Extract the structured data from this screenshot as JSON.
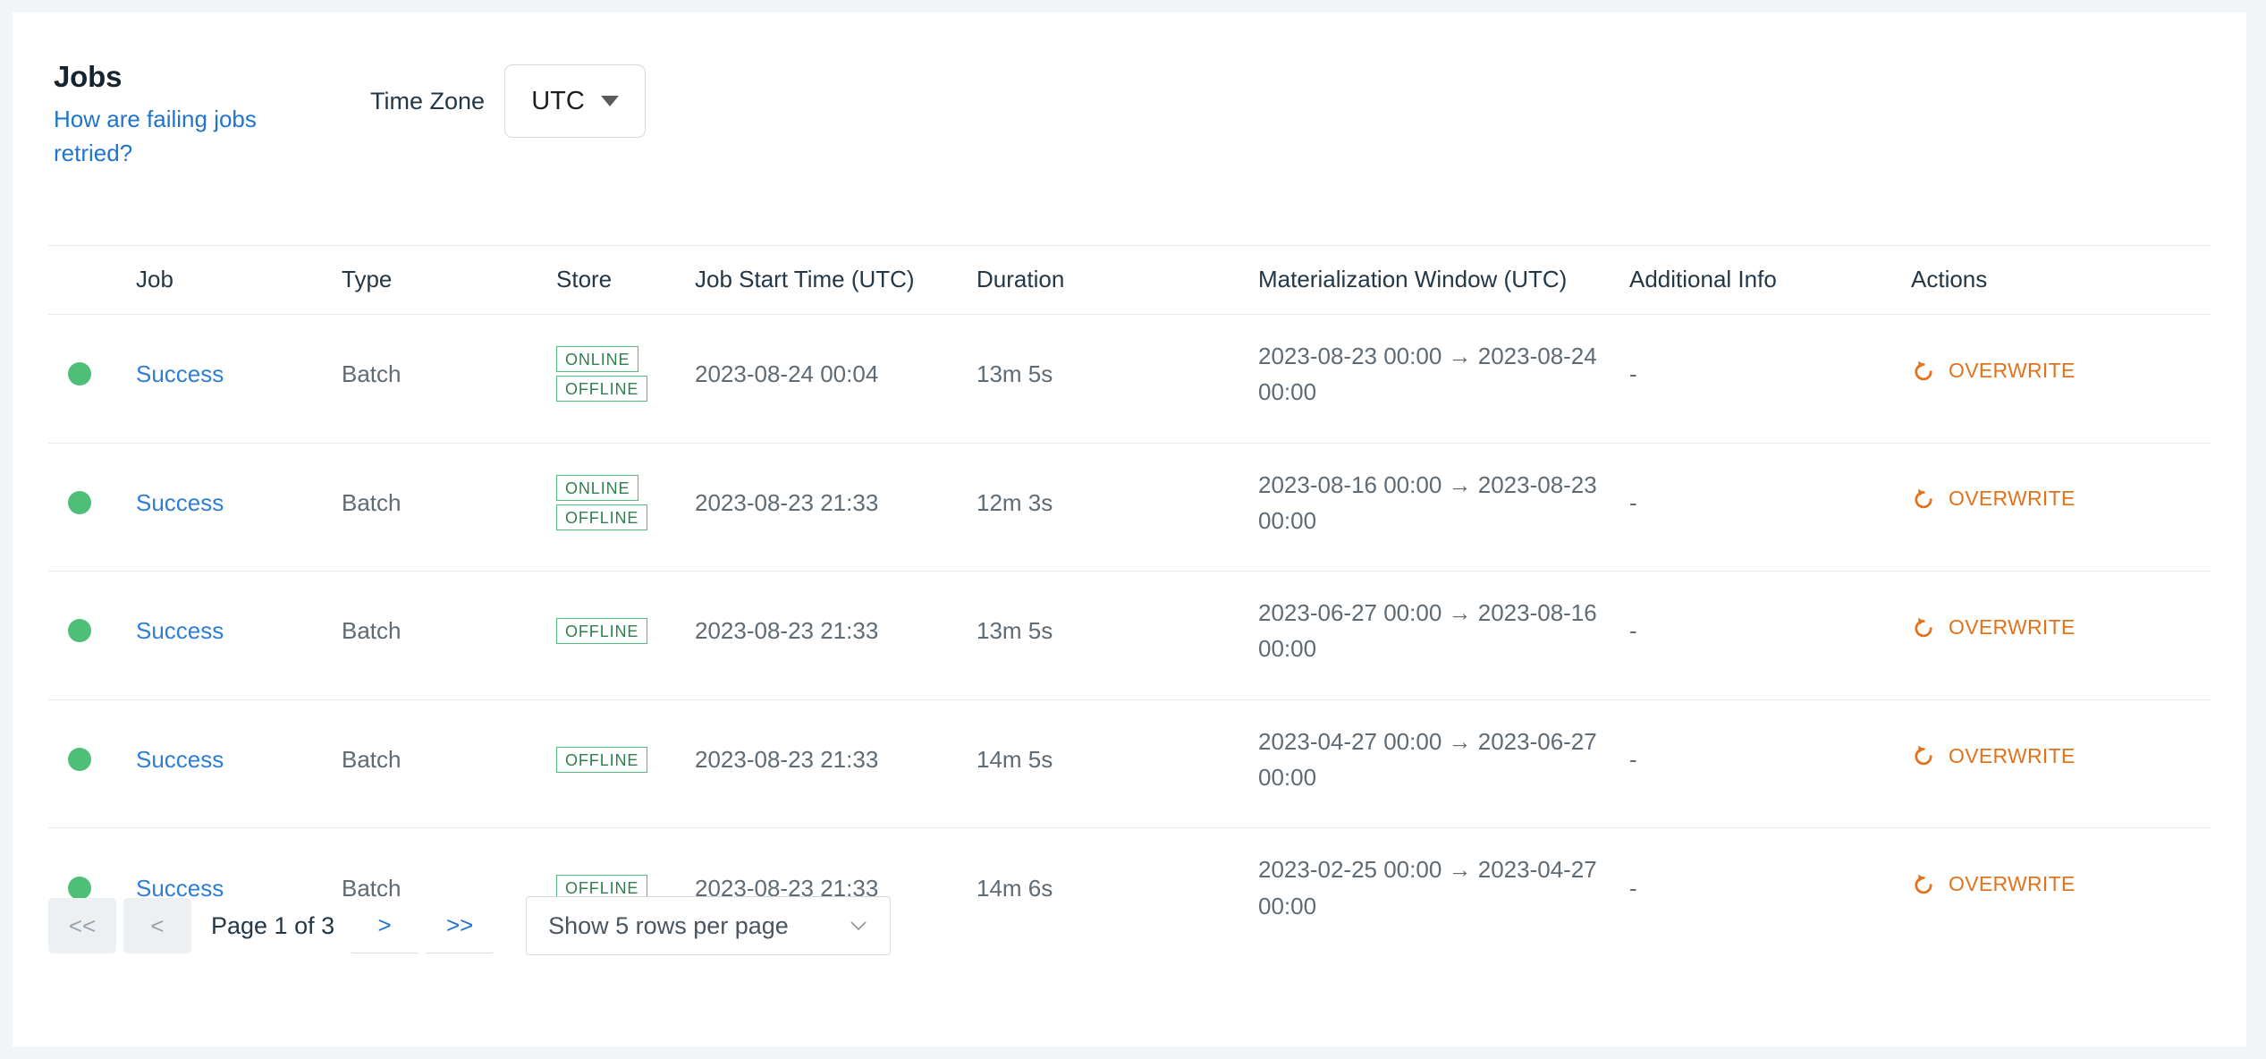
{
  "header": {
    "title": "Jobs",
    "help_link": "How are failing jobs retried?",
    "timezone_label": "Time Zone",
    "timezone_value": "UTC"
  },
  "table": {
    "columns": [
      "",
      "Job",
      "Type",
      "Store",
      "Job Start Time (UTC)",
      "Duration",
      "Materialization Window (UTC)",
      "Additional Info",
      "Actions"
    ],
    "rows": [
      {
        "status": "success",
        "job": "Success",
        "type": "Batch",
        "stores": [
          "ONLINE",
          "OFFLINE"
        ],
        "start_time": "2023-08-24 00:04",
        "duration": "13m 5s",
        "window": "2023-08-23 00:00 → 2023-08-24 00:00",
        "additional_info": "-",
        "action": "OVERWRITE"
      },
      {
        "status": "success",
        "job": "Success",
        "type": "Batch",
        "stores": [
          "ONLINE",
          "OFFLINE"
        ],
        "start_time": "2023-08-23 21:33",
        "duration": "12m 3s",
        "window": "2023-08-16 00:00 → 2023-08-23 00:00",
        "additional_info": "-",
        "action": "OVERWRITE"
      },
      {
        "status": "success",
        "job": "Success",
        "type": "Batch",
        "stores": [
          "OFFLINE"
        ],
        "start_time": "2023-08-23 21:33",
        "duration": "13m 5s",
        "window": "2023-06-27 00:00 → 2023-08-16 00:00",
        "additional_info": "-",
        "action": "OVERWRITE"
      },
      {
        "status": "success",
        "job": "Success",
        "type": "Batch",
        "stores": [
          "OFFLINE"
        ],
        "start_time": "2023-08-23 21:33",
        "duration": "14m 5s",
        "window": "2023-04-27 00:00 → 2023-06-27 00:00",
        "additional_info": "-",
        "action": "OVERWRITE"
      },
      {
        "status": "success",
        "job": "Success",
        "type": "Batch",
        "stores": [
          "OFFLINE"
        ],
        "start_time": "2023-08-23 21:33",
        "duration": "14m 6s",
        "window": "2023-02-25 00:00 → 2023-04-27 00:00",
        "additional_info": "-",
        "action": "OVERWRITE"
      }
    ]
  },
  "pagination": {
    "first_label": "<<",
    "prev_label": "<",
    "page_info": "Page 1 of 3",
    "next_label": ">",
    "last_label": ">>",
    "rows_per_page_label": "Show 5 rows per page"
  },
  "colors": {
    "link": "#1f75cb",
    "status_green": "#4fbe79",
    "badge_green": "#56b97d",
    "action_orange": "#e2721c",
    "page_bg": "#f2f5f7"
  }
}
